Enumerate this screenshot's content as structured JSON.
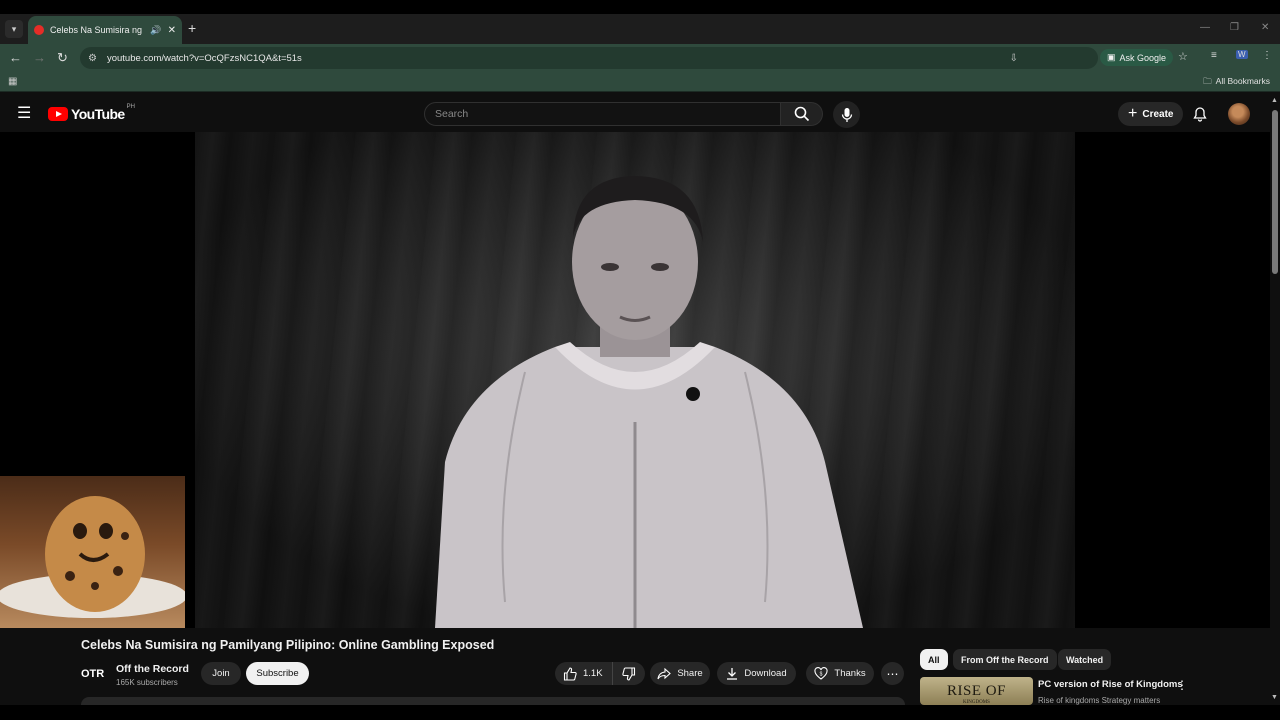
{
  "browser": {
    "tab_title": "Celebs Na Sumisira ng Pam",
    "url": "youtube.com/watch?v=OcQFzsNC1QA&t=51s",
    "ask_google": "Ask Google",
    "all_bookmarks": "All Bookmarks"
  },
  "header": {
    "logo_text": "YouTube",
    "country_code": "PH",
    "search_placeholder": "Search",
    "create_label": "Create"
  },
  "video": {
    "title": "Celebs Na Sumisira ng Pamilyang Pilipino: Online Gambling Exposed",
    "channel_logo": "OTR",
    "channel_name": "Off the Record",
    "subscribers": "165K subscribers",
    "join_label": "Join",
    "subscribe_label": "Subscribe",
    "like_count": "1.1K",
    "share_label": "Share",
    "download_label": "Download",
    "thanks_label": "Thanks"
  },
  "sidebar": {
    "chips": [
      "All",
      "From Off the Record",
      "Watched"
    ],
    "recommendation": {
      "thumb_text": "RISE OF",
      "thumb_sub": "KINGDOMS",
      "title": "PC version of Rise of Kingdoms",
      "channel": "Rise of kingdoms Strategy matters"
    }
  },
  "colors": {
    "accent": "#ff0000",
    "browser_theme": "#2f4a3d",
    "background": "#0f0f0f"
  }
}
